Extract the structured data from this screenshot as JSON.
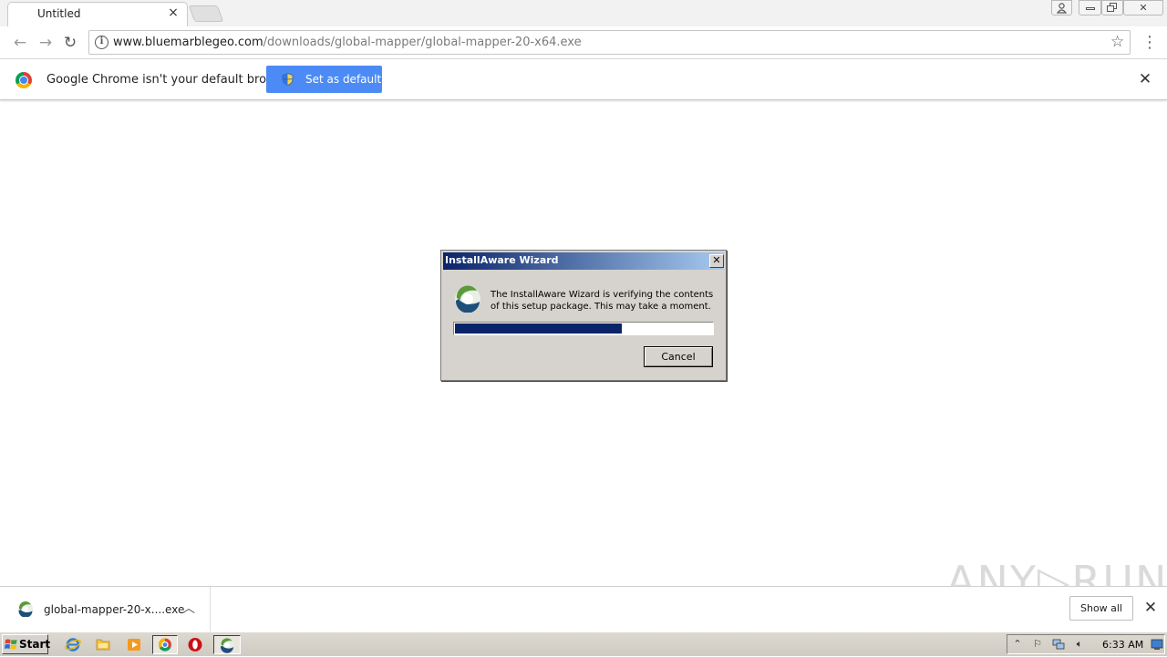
{
  "browser": {
    "tab_title": "Untitled",
    "url_host": "www.bluemarblegeo.com",
    "url_path": "/downloads/global-mapper/global-mapper-20-x64.exe"
  },
  "infobar": {
    "message": "Google Chrome isn't your default browser",
    "set_default_label": "Set as default"
  },
  "dialog": {
    "title": "InstallAware Wizard",
    "message": "The InstallAware Wizard is verifying the contents of this setup package. This may take a moment.",
    "progress_fraction": 0.65,
    "cancel_label": "Cancel",
    "close_glyph": "✕"
  },
  "downloads": {
    "filename": "global-mapper-20-x....exe",
    "show_all_label": "Show all"
  },
  "watermark": "ANY▷RUN",
  "taskbar": {
    "start_label": "Start",
    "clock": "6:33 AM"
  },
  "colors": {
    "chrome_blue": "#4c8bf5",
    "dialog_face": "#d6d3ce",
    "title_gradient_start": "#0a246a",
    "title_gradient_end": "#a6caf0",
    "progress_fill": "#0a246a"
  }
}
